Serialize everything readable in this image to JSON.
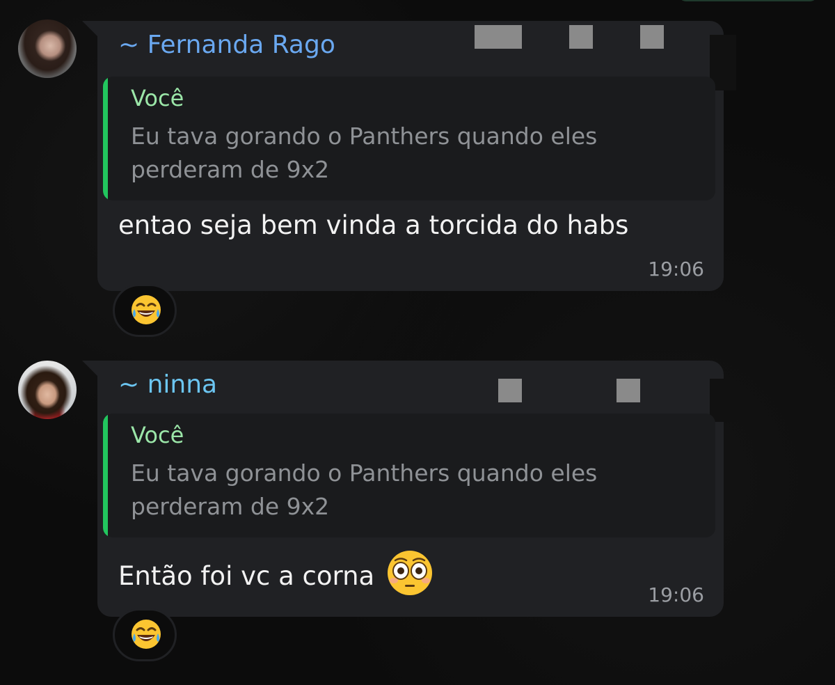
{
  "messages": [
    {
      "sender": "~ Fernanda Rago",
      "quote_author": "Você",
      "quote_text": "Eu tava gorando o Panthers quando eles perderam de 9x2",
      "text": "entao seja bem vinda a torcida do habs",
      "time": "19:06",
      "reaction": "joy-emoji"
    },
    {
      "sender": "~ ninna",
      "quote_author": "Você",
      "quote_text": "Eu tava gorando o Panthers quando eles perderam de 9x2",
      "text": "Então foi vc a corna",
      "inline_emoji": "flushed-emoji",
      "time": "19:06",
      "reaction": "joy-emoji"
    }
  ],
  "colors": {
    "background": "#0c0c0c",
    "bubble": "#202124",
    "quote_bar": "#22c55e",
    "quote_author": "#9be6a8",
    "sender_1": "#6aa8f0",
    "sender_2": "#6cc6f2"
  }
}
